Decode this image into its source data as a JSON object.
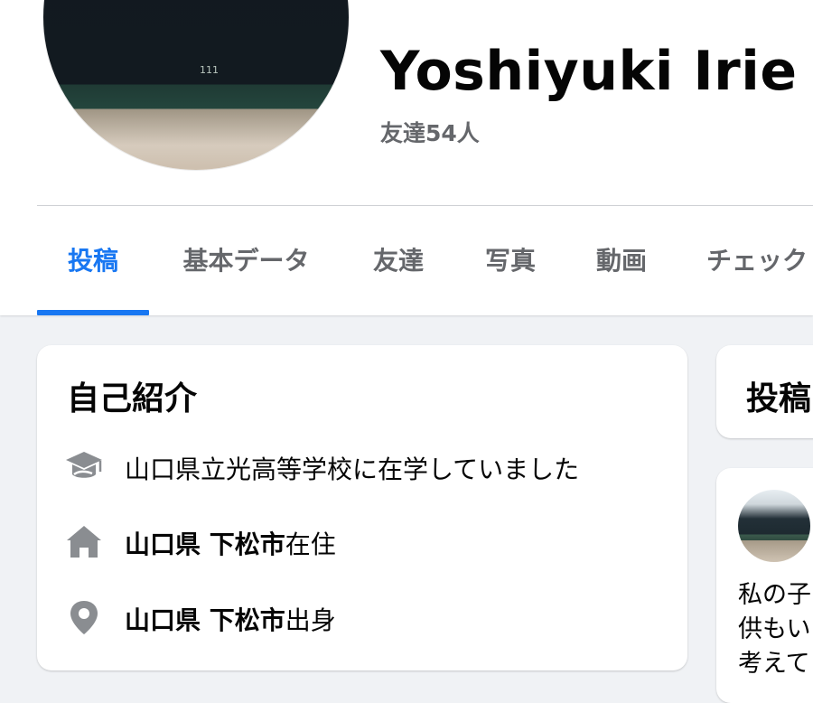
{
  "profile": {
    "name": "Yoshiyuki Irie",
    "friends": "友達54人",
    "avatar_fence_number": "111"
  },
  "tabs": [
    {
      "label": "投稿",
      "active": true
    },
    {
      "label": "基本データ",
      "active": false
    },
    {
      "label": "友達",
      "active": false
    },
    {
      "label": "写真",
      "active": false
    },
    {
      "label": "動画",
      "active": false
    },
    {
      "label": "チェック",
      "active": false
    }
  ],
  "intro": {
    "title": "自己紹介",
    "education": "山口県立光高等学校に在学していました",
    "residence": {
      "place": "山口県 下松市",
      "suffix": "在住"
    },
    "hometown": {
      "place": "山口県 下松市",
      "suffix": "出身"
    }
  },
  "posts": {
    "title": "投稿",
    "first_post_text_lines": [
      "私の子",
      "供もい",
      "考えて"
    ]
  },
  "colors": {
    "accent": "#1877f2",
    "secondary_text": "#65676b",
    "icon_gray": "#8a8d91",
    "background": "#f0f2f5"
  },
  "icons": [
    "graduation-cap-icon",
    "home-icon",
    "location-pin-icon"
  ]
}
